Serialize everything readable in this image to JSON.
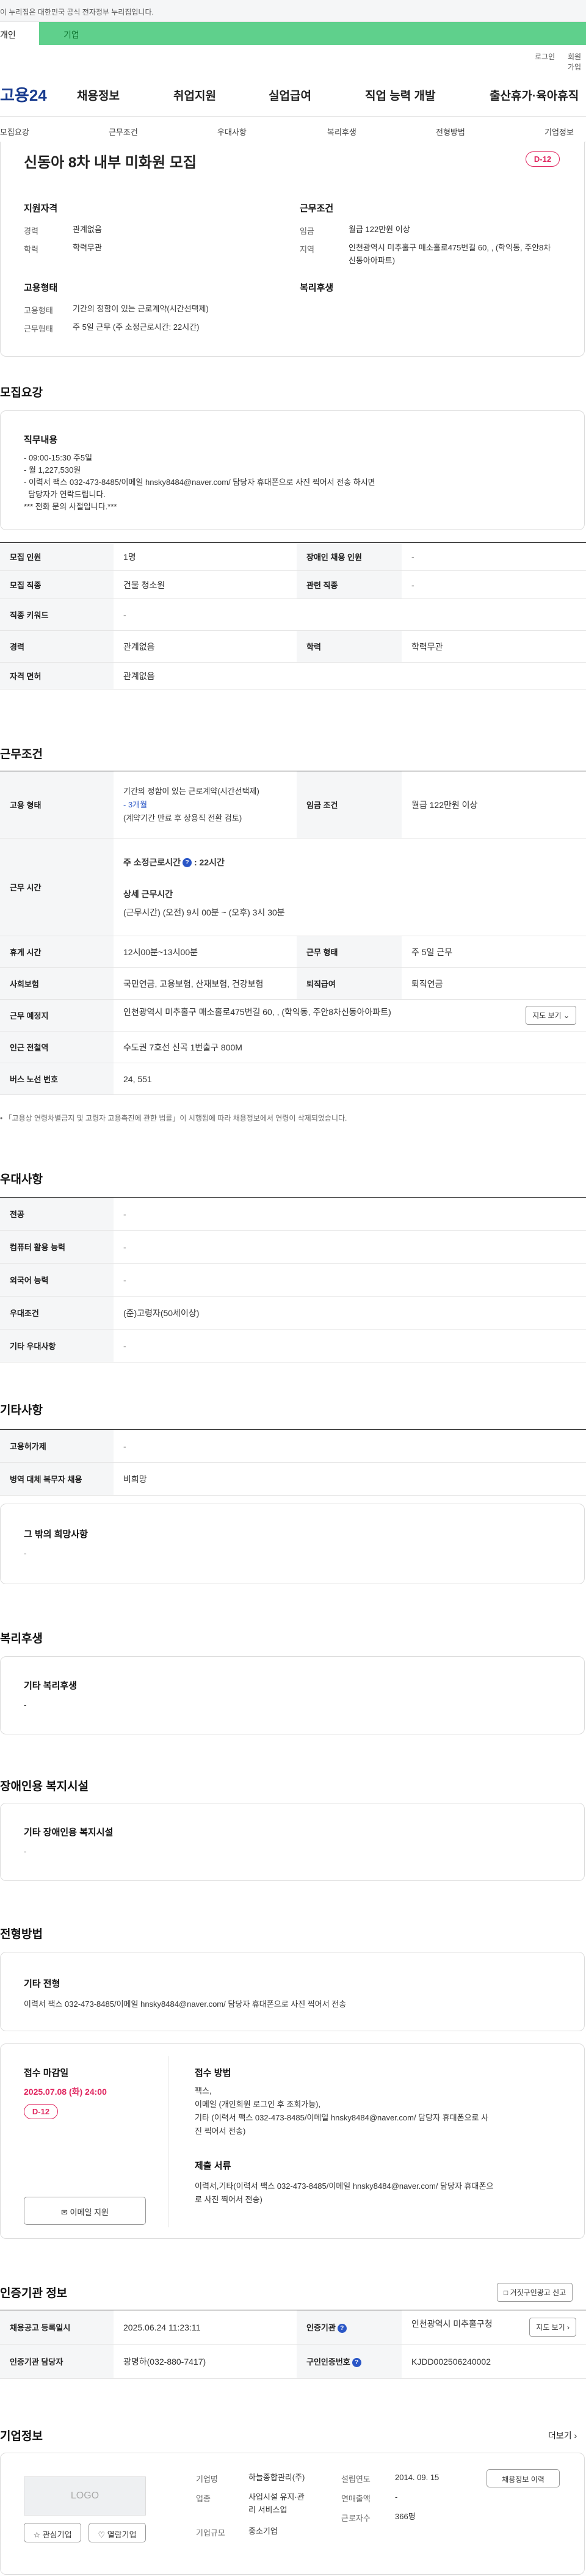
{
  "gov_banner": {
    "text": "이 누리집은 대한민국 공식 전자정부 누리집입니다."
  },
  "site_tabs": {
    "personal": "개인",
    "company": "기업"
  },
  "util": {
    "login": "로그인",
    "join": "회원가입"
  },
  "header": {
    "logo": "고용24",
    "gnb": [
      "채용정보",
      "취업지원",
      "실업급여",
      "직업 능력 개발",
      "출산휴가·육아휴직"
    ]
  },
  "lnb": [
    "모집요강",
    "근무조건",
    "우대사항",
    "복리후생",
    "전형방법",
    "기업정보"
  ],
  "summary": {
    "title": "신동아 8차 내부 미화원 모집",
    "dday": "D-12",
    "qual": {
      "heading": "지원자격",
      "rows": [
        {
          "label": "경력",
          "value": "관계없음"
        },
        {
          "label": "학력",
          "value": "학력무관"
        }
      ]
    },
    "work": {
      "heading": "근무조건",
      "rows": [
        {
          "label": "임금",
          "value": "월급 122만원 이상"
        },
        {
          "label": "지역",
          "value": "인천광역시 미추홀구 매소홀로475번길 60, , (학익동, 주안8차신동아아파트)"
        }
      ]
    },
    "employ": {
      "heading": "고용형태",
      "rows": [
        {
          "label": "고용형태",
          "value": "기간의 정함이 있는 근로계약(시간선택제)"
        },
        {
          "label": "근무형태",
          "value": "주 5일 근무 (주 소정근로시간: 22시간)"
        }
      ]
    },
    "welfare": {
      "heading": "복리후생"
    }
  },
  "recruit": {
    "heading": "모집요강",
    "duty_heading": "직무내용",
    "duty_lines": [
      "- 09:00-15:30 주5일",
      "- 월 1,227,530원",
      "- 이력서 팩스 032-473-8485/이메일 hnsky8484@naver.com/ 담당자 휴대폰으로 사진 찍어서 전송 하시면",
      "  담당자가 연락드립니다.",
      "*** 전화 문의 사절입니다.***"
    ],
    "table": {
      "persons_l": "모집 인원",
      "persons_v": "1명",
      "disabled_l": "장애인 채용 인원",
      "disabled_v": "-",
      "job_l": "모집 직종",
      "job_v": "건물 청소원",
      "related_l": "관련 직종",
      "related_v": "-",
      "keyword_l": "직종 키워드",
      "keyword_v": "-",
      "career_l": "경력",
      "career_v": "관계없음",
      "edu_l": "학력",
      "edu_v": "학력무관",
      "license_l": "자격 면허",
      "license_v": "관계없음"
    }
  },
  "conditions": {
    "heading": "근무조건",
    "employ_l": "고용 형태",
    "employ_v1": "기간의 정함이 있는 근로계약(시간선택제)",
    "employ_v2": "- 3개월",
    "employ_v3": "(계약기간 만료 후 상용직 전환 검토)",
    "wage_l": "임금 조건",
    "wage_v": "월급 122만원 이상",
    "hours_l": "근무 시간",
    "hours_total": "주 소정근로시간",
    "hours_total_v": "22시간",
    "hours_detail_h": "상세 근무시간",
    "hours_detail_v": "(근무시간) (오전) 9시 00분 ~ (오후) 3시 30분",
    "break_l": "휴게 시간",
    "break_v": "12시00분~13시00분",
    "form_l": "근무 형태",
    "form_v": "주 5일 근무",
    "insurance_l": "사회보험",
    "insurance_v": "국민연금, 고용보험, 산재보험, 건강보험",
    "retire_l": "퇴직급여",
    "retire_v": "퇴직연금",
    "place_l": "근무 예정지",
    "place_v": "인천광역시 미추홀구 매소홀로475번길 60, , (학익동, 주안8차신동아아파트)",
    "map_btn": "지도 보기",
    "subway_l": "인근 전철역",
    "subway_v": "수도권 7호선 신곡 1번출구 800M",
    "bus_l": "버스 노선 번호",
    "bus_v": "24, 551",
    "note": "「고용상 연령차별금지 및 고령자 고용촉진에 관한 법률」이 시행됨에 따라 채용정보에서 연령이 삭제되었습니다."
  },
  "pref": {
    "heading": "우대사항",
    "rows": [
      {
        "label": "전공",
        "value": "-"
      },
      {
        "label": "컴퓨터 활용 능력",
        "value": "-"
      },
      {
        "label": "외국어 능력",
        "value": "-"
      },
      {
        "label": "우대조건",
        "value": "(준)고령자(50세이상)"
      },
      {
        "label": "기타 우대사항",
        "value": "-"
      }
    ]
  },
  "etc": {
    "heading": "기타사항",
    "rows": [
      {
        "label": "고용허가제",
        "value": "-"
      },
      {
        "label": "병역 대체 복무자 채용",
        "value": "비희망"
      }
    ],
    "hope_h": "그 밖의 희망사항",
    "hope_v": "-"
  },
  "welfare": {
    "heading": "복리후생",
    "card_h": "기타 복리후생",
    "card_v": "-"
  },
  "disabled_fac": {
    "heading": "장애인용 복지시설",
    "card_h": "기타 장애인용 복지시설",
    "card_v": "-"
  },
  "selection": {
    "heading": "전형방법",
    "etc_h": "기타 전형",
    "etc_v": "이력서 팩스 032-473-8485/이메일 hnsky8484@naver.com/ 담당자 휴대폰으로 사진 찍어서 전송",
    "deadline_h": "접수 마감일",
    "deadline_v": "2025.07.08 (화) 24:00",
    "dday": "D-12",
    "email_btn": "이메일 지원",
    "method_h": "접수 방법",
    "method_lines": [
      "팩스,",
      "이메일 (개인회원 로그인 후 조회가능),",
      "기타 (이력서 팩스 032-473-8485/이메일 hnsky8484@naver.com/ 담당자 휴대폰으로 사",
      "진 찍어서 전송)"
    ],
    "docs_h": "제출 서류",
    "docs_lines": [
      "이력서,기타(이력서 팩스 032-473-8485/이메일 hnsky8484@naver.com/ 담당자 휴대폰으",
      "로 사진 찍어서 전송)"
    ]
  },
  "agency": {
    "heading": "인증기관 정보",
    "report_btn": "거짓구인광고 신고",
    "reg_l": "채용공고 등록일시",
    "reg_v": "2025.06.24 11:23:11",
    "org_l": "인증기관",
    "org_v": "인천광역시 미추홀구청",
    "map_btn": "지도 보기",
    "mgr_l": "인증기관 담당자",
    "mgr_v": "광명하(032-880-7417)",
    "no_l": "구인인증번호",
    "no_v": "KJDD002506240002"
  },
  "company": {
    "heading": "기업정보",
    "more": "더보기",
    "logo": "LOGO",
    "fav_btn": "관심기업",
    "follow_btn": "열람기업",
    "name_l": "기업명",
    "name_v": "하늘종합관리(주)",
    "ind_l": "업종",
    "ind_v1": "사업시설 유지·관",
    "ind_v2": "리 서비스업",
    "size_l": "기업규모",
    "size_v": "중소기업",
    "est_l": "설립연도",
    "est_v": "2014. 09. 15",
    "sales_l": "연매출액",
    "sales_v": "-",
    "emp_l": "근로자수",
    "emp_v": "366명",
    "info_btn": "채용정보 이력"
  }
}
